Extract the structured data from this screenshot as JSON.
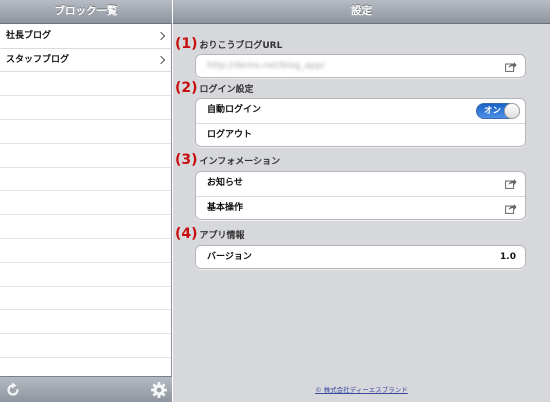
{
  "left_pane": {
    "title": "ブロック一覧",
    "items": [
      {
        "label": "社長ブログ"
      },
      {
        "label": "スタッフブログ"
      }
    ],
    "toolbar": {
      "refresh_icon": "refresh-icon",
      "settings_icon": "gear-icon"
    }
  },
  "right_pane": {
    "title": "設定",
    "sections": [
      {
        "number": "(1)",
        "title": "おりこうブログURL",
        "rows": [
          {
            "label": "http://demo.net/blog_app/",
            "icon": "share-icon"
          }
        ]
      },
      {
        "number": "(2)",
        "title": "ログイン設定",
        "rows": [
          {
            "label": "自動ログイン",
            "toggle": "オン"
          },
          {
            "label": "ログアウト"
          }
        ]
      },
      {
        "number": "(3)",
        "title": "インフォメーション",
        "rows": [
          {
            "label": "お知らせ",
            "icon": "share-icon"
          },
          {
            "label": "基本操作",
            "icon": "share-icon"
          }
        ]
      },
      {
        "number": "(4)",
        "title": "アプリ情報",
        "rows": [
          {
            "label": "バージョン",
            "value": "1.0"
          }
        ]
      }
    ],
    "footer": "© 株式会社ディーエスブランド"
  },
  "colors": {
    "accent_red": "#c80f0f",
    "toggle_blue": "#2a72d5",
    "settings_background": "#d7d8dc"
  }
}
